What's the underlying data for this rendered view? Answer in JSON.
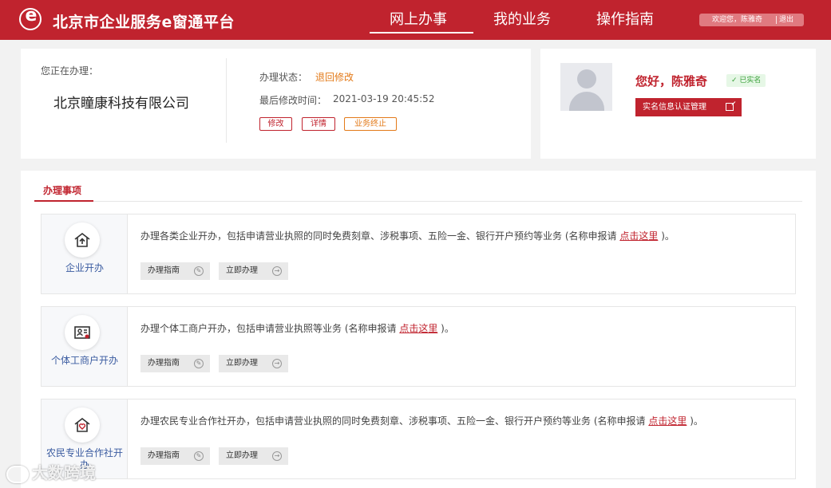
{
  "header": {
    "logo_letter": "e",
    "brand": "北京市企业服务e窗通平台",
    "nav": [
      "网上办事",
      "我的业务",
      "操作指南"
    ],
    "active_nav": "网上办事",
    "welcome": "欢迎您，陈雅奇",
    "logout": "退出"
  },
  "current": {
    "doing_label": "您正在办理：",
    "company": "北京瞳康科技有限公司",
    "status_label": "办理状态：",
    "status_value": "退回修改",
    "modified_label": "最后修改时间：",
    "modified_value": "2021-03-19 20:45:52",
    "actions": [
      "修改",
      "详情",
      "业务终止"
    ]
  },
  "user": {
    "greeting": "您好，陈雅奇",
    "verified": "已实名",
    "realname_button": "实名信息认证管理"
  },
  "tab": "办理事项",
  "link_text": "点击这里",
  "guide_label": "办理指南",
  "start_label": "立即办理",
  "services": [
    {
      "name": "企业开办",
      "icon": "house-upload-icon",
      "desc_before": "办理各类企业开办，包括申请营业执照的同时免费刻章、涉税事项、五险一金、银行开户预约等业务 (名称申报请",
      "desc_after": ")。"
    },
    {
      "name": "个体工商户开办",
      "icon": "id-card-icon",
      "desc_before": "办理个体工商户开办，包括申请营业执照等业务 (名称申报请",
      "desc_after": ")。"
    },
    {
      "name": "农民专业合作社开办",
      "icon": "heart-house-icon",
      "desc_before": "办理农民专业合作社开办，包括申请营业执照的同时免费刻章、涉税事项、五险一金、银行开户预约等业务 (名称申报请",
      "desc_after": ")。"
    }
  ],
  "watermark": "大数跨境",
  "colors": {
    "brand_red": "#c0232e",
    "status_orange": "#e37a19",
    "link_blue": "#3a5ba0",
    "verified_green": "#3aa03a"
  }
}
